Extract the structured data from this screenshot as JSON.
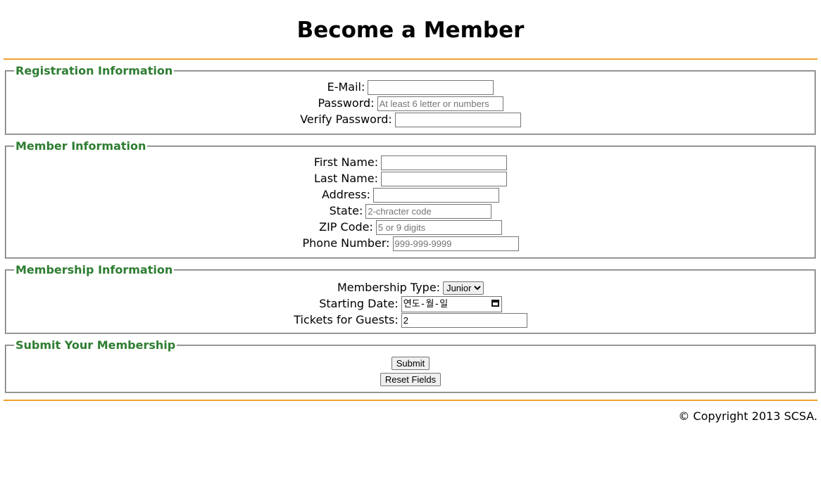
{
  "page": {
    "title": "Become a Member"
  },
  "registration": {
    "legend": "Registration Information",
    "email": {
      "label": "E-Mail:",
      "value": "",
      "placeholder": ""
    },
    "password": {
      "label": "Password:",
      "value": "",
      "placeholder": "At least 6 letter or numbers"
    },
    "verify": {
      "label": "Verify Password:",
      "value": "",
      "placeholder": ""
    }
  },
  "member": {
    "legend": "Member Information",
    "first_name": {
      "label": "First Name:",
      "value": "",
      "placeholder": ""
    },
    "last_name": {
      "label": "Last Name:",
      "value": "",
      "placeholder": ""
    },
    "address": {
      "label": "Address:",
      "value": "",
      "placeholder": ""
    },
    "state": {
      "label": "State:",
      "value": "",
      "placeholder": "2-chracter code"
    },
    "zip": {
      "label": "ZIP Code:",
      "value": "",
      "placeholder": "5 or 9 digits"
    },
    "phone": {
      "label": "Phone Number:",
      "value": "",
      "placeholder": "999-999-9999"
    }
  },
  "membership": {
    "legend": "Membership Information",
    "type": {
      "label": "Membership Type:",
      "selected": "Junior"
    },
    "start_date": {
      "label": "Starting Date:",
      "display": "연도-월-일",
      "icon": "calendar-icon"
    },
    "tickets": {
      "label": "Tickets for Guests:",
      "value": "2",
      "placeholder": ""
    }
  },
  "submit": {
    "legend": "Submit Your Membership",
    "submit_label": "Submit",
    "reset_label": "Reset Fields"
  },
  "footer": {
    "copyright": "© Copyright 2013 SCSA."
  },
  "colors": {
    "legend": "#2e7d32",
    "rule": "#f0a030"
  }
}
